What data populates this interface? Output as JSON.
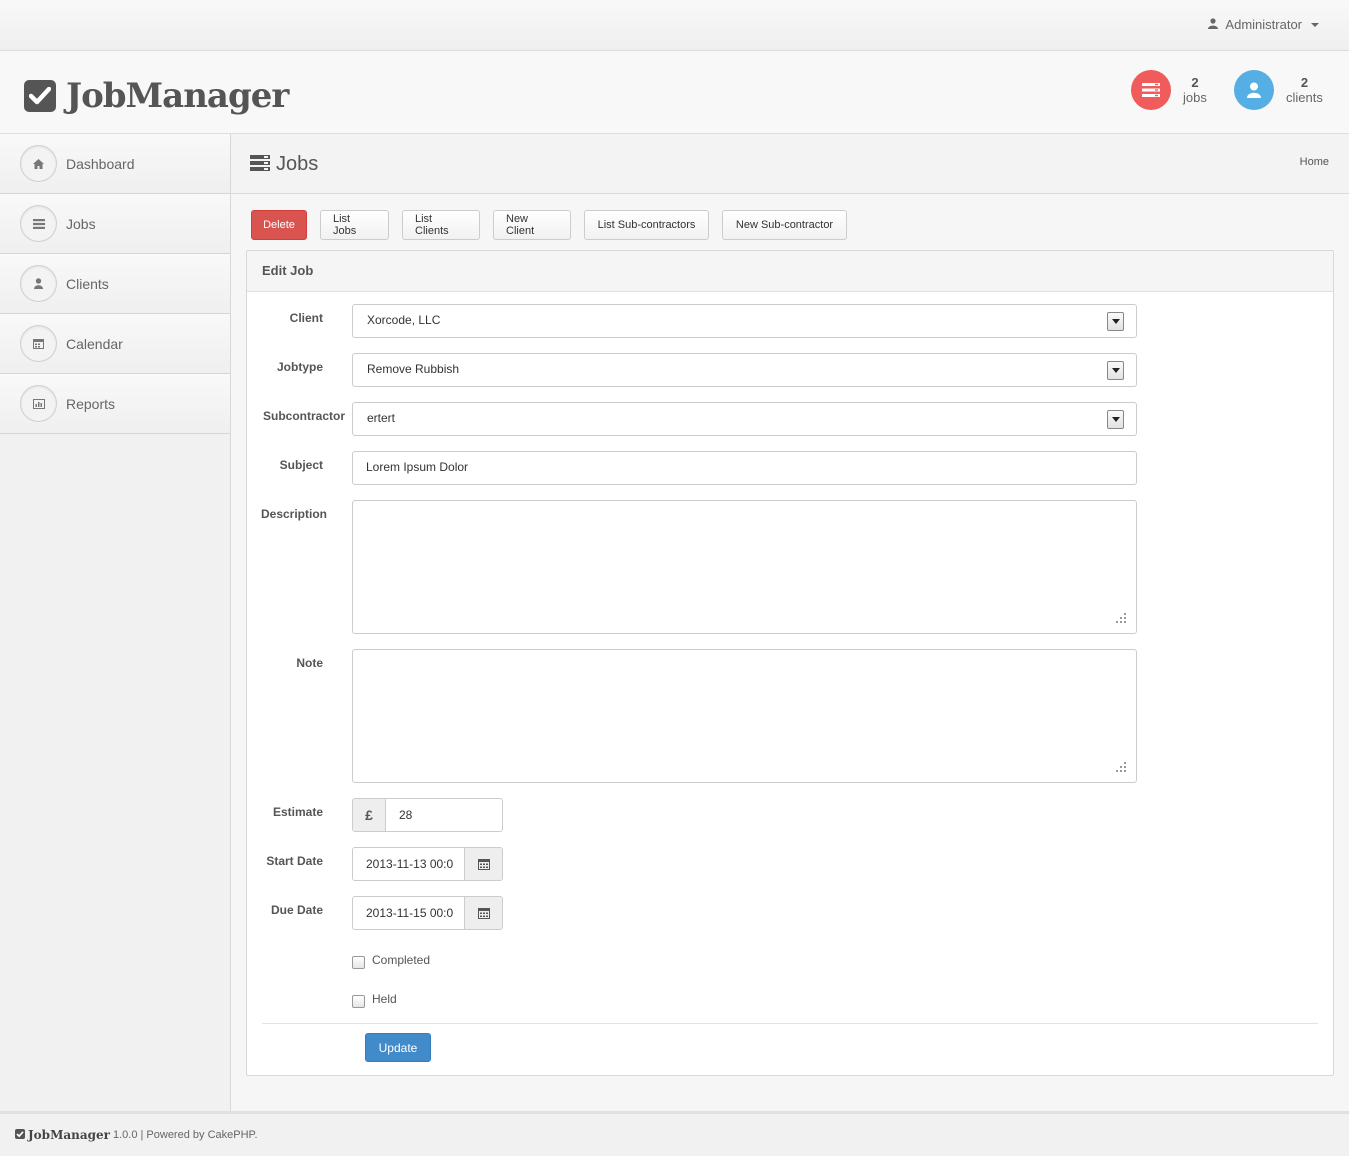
{
  "topbar": {
    "user_label": "Administrator"
  },
  "header": {
    "app_name": "JobManager",
    "stats": [
      {
        "count": "2",
        "label": "jobs",
        "color": "#f05b5b"
      },
      {
        "count": "2",
        "label": "clients",
        "color": "#55aee4"
      }
    ]
  },
  "sidebar": {
    "items": [
      {
        "label": "Dashboard",
        "icon": "home-icon"
      },
      {
        "label": "Jobs",
        "icon": "list-icon"
      },
      {
        "label": "Clients",
        "icon": "user-icon"
      },
      {
        "label": "Calendar",
        "icon": "calendar-icon"
      },
      {
        "label": "Reports",
        "icon": "bar-chart-icon"
      }
    ]
  },
  "page": {
    "title": "Jobs",
    "breadcrumb": "Home"
  },
  "actions": {
    "delete": "Delete",
    "list_jobs": "List Jobs",
    "list_clients": "List Clients",
    "new_client": "New Client",
    "list_subcontractors": "List Sub-contractors",
    "new_subcontractor": "New Sub-contractor"
  },
  "form": {
    "panel_title": "Edit Job",
    "client": {
      "label": "Client",
      "value": "Xorcode, LLC"
    },
    "jobtype": {
      "label": "Jobtype",
      "value": "Remove Rubbish"
    },
    "subcontractor": {
      "label": "Subcontractor",
      "value": "ertert"
    },
    "subject": {
      "label": "Subject",
      "value": "Lorem Ipsum Dolor"
    },
    "description": {
      "label": "Description",
      "value": ""
    },
    "note": {
      "label": "Note",
      "value": ""
    },
    "estimate": {
      "label": "Estimate",
      "currency": "£",
      "value": "28"
    },
    "start_date": {
      "label": "Start Date",
      "value": "2013-11-13 00:0"
    },
    "due_date": {
      "label": "Due Date",
      "value": "2013-11-15 00:0"
    },
    "completed": {
      "label": "Completed",
      "checked": false
    },
    "held": {
      "label": "Held",
      "checked": false
    },
    "submit": "Update"
  },
  "footer": {
    "app_name": "JobManager",
    "text": "1.0.0 | Powered by CakePHP."
  }
}
